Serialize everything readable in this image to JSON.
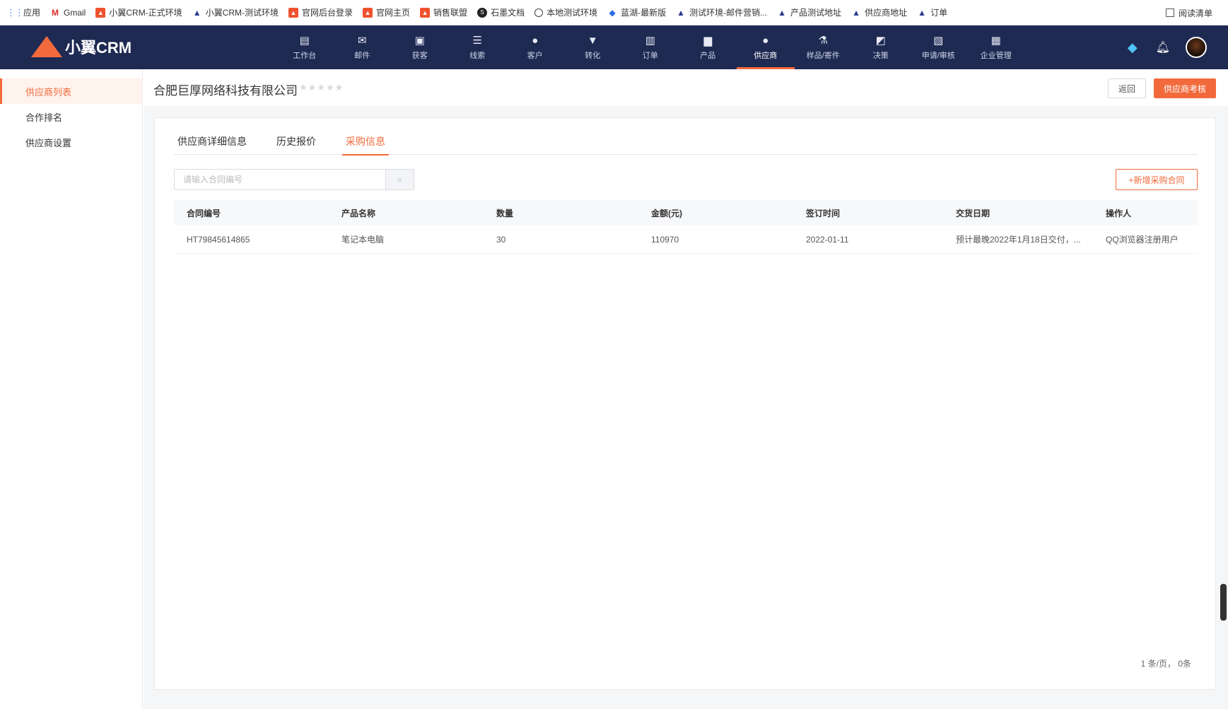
{
  "bookmarks": [
    {
      "label": "应用",
      "icon": "apps-grid-icon"
    },
    {
      "label": "Gmail",
      "icon": "gmail-icon"
    },
    {
      "label": "小翼CRM-正式环境",
      "icon": "crm-square-icon"
    },
    {
      "label": "小翼CRM-测试环境",
      "icon": "triangle-logo-icon"
    },
    {
      "label": "官网后台登录",
      "icon": "crm-square-icon"
    },
    {
      "label": "官网主页",
      "icon": "crm-square-icon"
    },
    {
      "label": "销售联盟",
      "icon": "crm-square-icon"
    },
    {
      "label": "石墨文档",
      "icon": "shimo-icon"
    },
    {
      "label": "本地测试环境",
      "icon": "globe-icon"
    },
    {
      "label": "蓝湖-最新版",
      "icon": "lanhu-icon"
    },
    {
      "label": "测试环境-邮件营销...",
      "icon": "triangle-logo-icon"
    },
    {
      "label": "产品测试地址",
      "icon": "triangle-logo-icon"
    },
    {
      "label": "供应商地址",
      "icon": "triangle-logo-icon"
    },
    {
      "label": "订单",
      "icon": "triangle-logo-icon"
    }
  ],
  "reading_list": "阅读清单",
  "logo_text": "小翼CRM",
  "nav": [
    {
      "label": "工作台",
      "glyph": "▤"
    },
    {
      "label": "邮件",
      "glyph": "✉"
    },
    {
      "label": "获客",
      "glyph": "▣"
    },
    {
      "label": "线索",
      "glyph": "☰"
    },
    {
      "label": "客户",
      "glyph": "●"
    },
    {
      "label": "转化",
      "glyph": "▼"
    },
    {
      "label": "订单",
      "glyph": "▥"
    },
    {
      "label": "产品",
      "glyph": "▆"
    },
    {
      "label": "供应商",
      "glyph": "●"
    },
    {
      "label": "样品/寄件",
      "glyph": "⚗"
    },
    {
      "label": "决策",
      "glyph": "◩"
    },
    {
      "label": "申请/审核",
      "glyph": "▧"
    },
    {
      "label": "企业管理",
      "glyph": "▦"
    }
  ],
  "nav_active_index": 8,
  "sidebar": {
    "items": [
      "供应商列表",
      "合作排名",
      "供应商设置"
    ],
    "active_index": 0
  },
  "header": {
    "company": "合肥巨厚网络科技有限公司",
    "stars": "★★★★★",
    "rating": 0,
    "back_label": "返回",
    "evaluate_label": "供应商考核"
  },
  "tabs": [
    "供应商详细信息",
    "历史报价",
    "采购信息"
  ],
  "tab_active_index": 2,
  "search": {
    "placeholder": "请输入合同编号",
    "value": ""
  },
  "add_contract_label": "+新增采购合同",
  "table": {
    "columns": [
      "合同编号",
      "产品名称",
      "数量",
      "金额(元)",
      "签订时间",
      "交货日期",
      "操作人"
    ],
    "rows": [
      [
        "HT79845614865",
        "笔记本电脑",
        "30",
        "110970",
        "2022-01-11",
        "预计最晚2022年1月18日交付，...",
        "QQ浏览器注册用户"
      ]
    ]
  },
  "pager_text": "1 条/页， 0条",
  "colors": {
    "nav_bg": "#1f2a53",
    "accent": "#f26a3b"
  }
}
